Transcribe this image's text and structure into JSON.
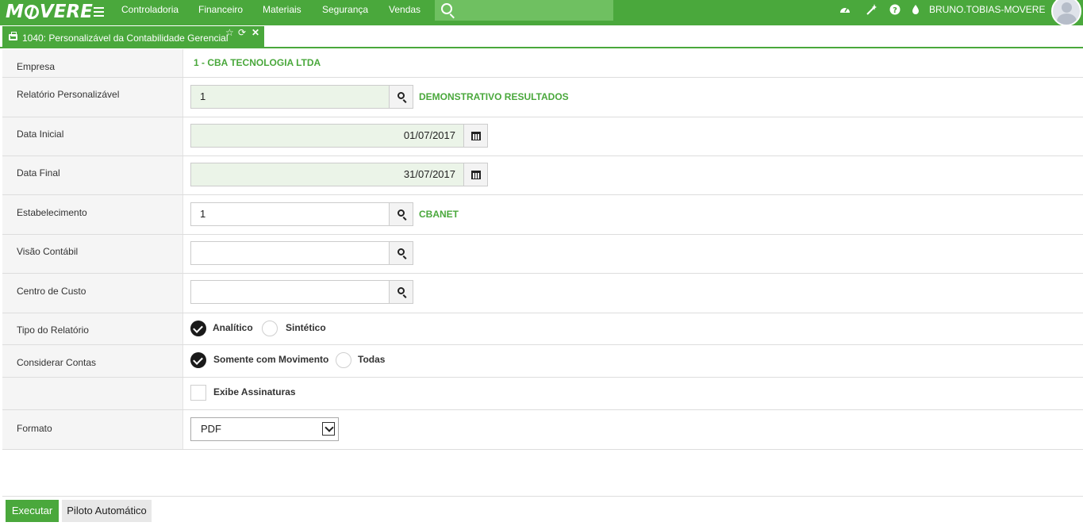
{
  "app": {
    "logo_text": "MOVERE",
    "nav": [
      "Controladoria",
      "Financeiro",
      "Materiais",
      "Segurança",
      "Vendas"
    ],
    "search_placeholder": "",
    "username": "BRUNO.TOBIAS-MOVERE",
    "brand_color": "#4aa83c"
  },
  "tab": {
    "title": "1040: Personalizável da Contabilidade Gerencial",
    "icons": [
      "printer-icon",
      "star-icon",
      "refresh-icon",
      "close-icon"
    ]
  },
  "form": {
    "empresa": {
      "label": "Empresa",
      "value": "1 - CBA TECNOLOGIA LTDA"
    },
    "relatorio": {
      "label": "Relatório Personalizável",
      "value": "1",
      "description": "DEMONSTRATIVO RESULTADOS"
    },
    "data_inicial": {
      "label": "Data Inicial",
      "value": "01/07/2017"
    },
    "data_final": {
      "label": "Data Final",
      "value": "31/07/2017"
    },
    "estabelecimento": {
      "label": "Estabelecimento",
      "value": "1",
      "description": "CBANET"
    },
    "visao_contabil": {
      "label": "Visão Contábil",
      "value": ""
    },
    "centro_custo": {
      "label": "Centro de Custo",
      "value": ""
    },
    "tipo_relatorio": {
      "label": "Tipo do Relatório",
      "options": [
        "Analítico",
        "Sintético"
      ],
      "selected": "Analítico"
    },
    "considerar_contas": {
      "label": "Considerar Contas",
      "options": [
        "Somente com Movimento",
        "Todas"
      ],
      "selected": "Somente com Movimento"
    },
    "exibe_assinaturas": {
      "label": "Exibe Assinaturas",
      "checked": false
    },
    "formato": {
      "label": "Formato",
      "value": "PDF"
    }
  },
  "footer": {
    "execute_label": "Executar",
    "autopilot_label": "Piloto Automático"
  }
}
